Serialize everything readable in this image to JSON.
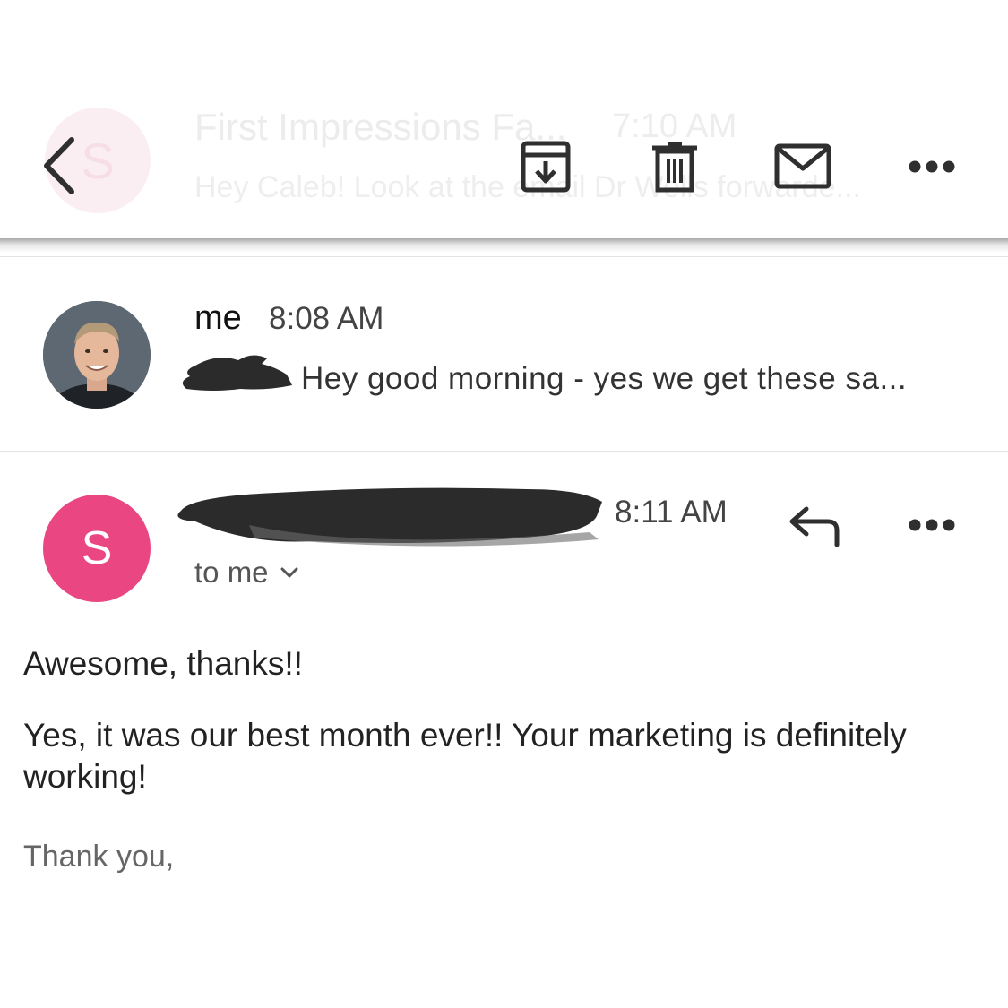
{
  "toolbar": {
    "ghost_avatar_letter": "S",
    "ghost_subject": "First Impressions Fa...",
    "ghost_time": "7:10 AM",
    "ghost_snippet": "Hey Caleb! Look at the email Dr Wells forwarde...",
    "icons": [
      "back-icon",
      "archive-icon",
      "delete-icon",
      "mail-icon",
      "more-icon"
    ]
  },
  "messages": [
    {
      "sender": "me",
      "time": "8:08 AM",
      "snippet": "Hey good morning - yes we get these sa..."
    },
    {
      "avatar_letter": "S",
      "avatar_color": "#e94682",
      "time": "8:11 AM",
      "recipients": "to me",
      "body": [
        "Awesome, thanks!!",
        "Yes, it was our best month ever!! Your marketing is definitely working!"
      ],
      "signoff": "Thank you,"
    }
  ],
  "colors": {
    "icon": "#2f2f2f",
    "redaction": "#2b2b2b"
  }
}
